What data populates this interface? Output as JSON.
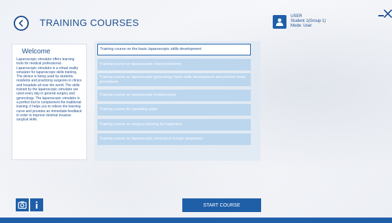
{
  "header": {
    "title": "TRAINING COURSES",
    "back_icon": "arrow-left-circle-icon"
  },
  "user": {
    "role": "USER",
    "name": "Student 1(Group 1)",
    "mode": "Mode: User",
    "avatar_icon": "user-avatar-icon"
  },
  "welcome": {
    "title": "Welcome",
    "text": "Laparoscopic simulator offers learning tools for medical professional. Laparoscopic simulator is a virtual reality simulator for laparoscopic skills training. The device is being used by students, residents and practicing surgeons in clinics and hospitals all over the world. The skills trained by the laparoscopic simulator are used every day in general surgery and gynecology. The laparoscopic simulator is a perfect tool to complement the traditional training; it helps you to relieve the learning curve and provides an immediate feedback in order to improve minimal invasive surgical skills."
  },
  "courses": [
    "Training course on the basic laparoscopic skills development",
    "Training course on laparoscopic cholecystectomy",
    "Training course on laparoscopic gynecology basic skills development and perform basic procedures",
    "Training course on laparoscopic hysterectomy",
    "Training course for operating sister",
    "Training course on surgical suturing for beginners",
    "Training course on laparoscopic removal of ectopic pregnancy"
  ],
  "selected_course_index": 0,
  "footer": {
    "start_label": "START COURSE",
    "camera_icon": "camera-icon",
    "info_icon": "info-icon"
  },
  "colors": {
    "primary": "#1f5fa8",
    "title_text": "#1f4f8f",
    "course_item": "#bcd6ee",
    "panel_bg": "#dee8f3"
  }
}
